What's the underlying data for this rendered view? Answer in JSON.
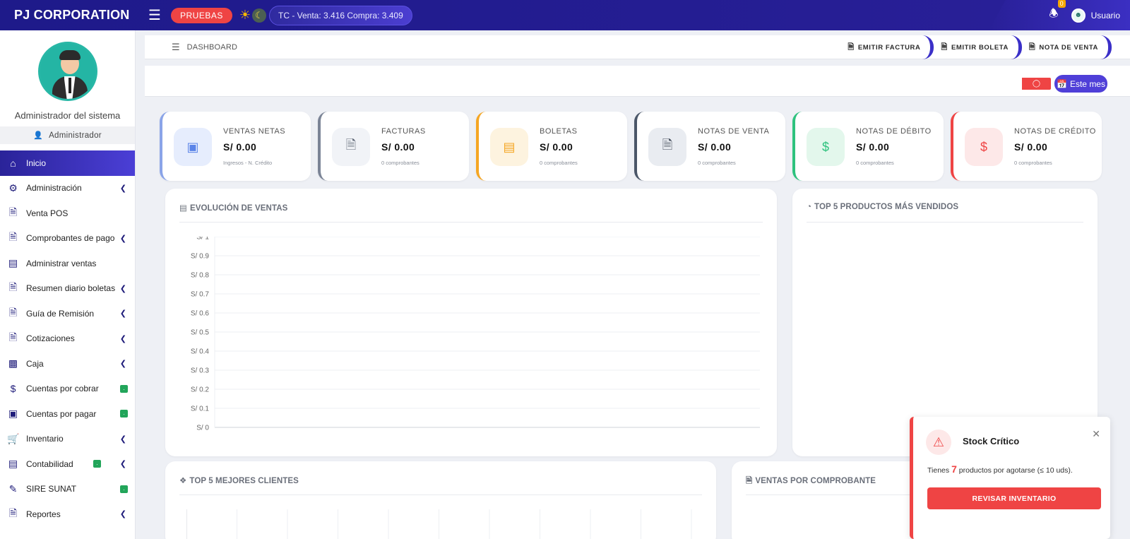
{
  "header": {
    "brand": "PJ CORPORATION",
    "env_badge": "PRUEBAS",
    "exchange_rate": "TC - Venta: 3.416 Compra: 3.409",
    "notification_count": "0",
    "user_label": "Usuario"
  },
  "sidebar": {
    "profile_name": "Administrador del sistema",
    "role": "Administrador",
    "items": [
      {
        "label": "Inicio",
        "icon": "home-icon"
      },
      {
        "label": "Administración",
        "icon": "gear-icon"
      },
      {
        "label": "Venta POS",
        "icon": "invoice-dollar-icon"
      },
      {
        "label": "Comprobantes de pago",
        "icon": "invoice-dollar-icon"
      },
      {
        "label": "Administrar ventas",
        "icon": "receipt-icon"
      },
      {
        "label": "Resumen diario boletas",
        "icon": "invoice-dollar-icon"
      },
      {
        "label": "Guía de Remisión",
        "icon": "file-icon"
      },
      {
        "label": "Cotizaciones",
        "icon": "file-icon"
      },
      {
        "label": "Caja",
        "icon": "cash-register-icon"
      },
      {
        "label": "Cuentas por cobrar",
        "icon": "hand-dollar-icon"
      },
      {
        "label": "Cuentas por pagar",
        "icon": "money-icon"
      },
      {
        "label": "Inventario",
        "icon": "cart-icon"
      },
      {
        "label": "Contabilidad",
        "icon": "book-icon"
      },
      {
        "label": "SIRE SUNAT",
        "icon": "edit-icon"
      },
      {
        "label": "Reportes",
        "icon": "invoice-dollar-icon"
      }
    ]
  },
  "breadcrumb": {
    "title": "DASHBOARD"
  },
  "quick_actions": [
    "EMITIR FACTURA",
    "EMITIR BOLETA",
    "NOTA DE VENTA"
  ],
  "filters": {
    "period_label": "Este mes"
  },
  "kpis": [
    {
      "label": "VENTAS NETAS",
      "value": "S/ 0.00",
      "sub": "Ingresos - N. Crédito",
      "color": "#8aa4e8"
    },
    {
      "label": "FACTURAS",
      "value": "S/ 0.00",
      "sub": "0 comprobantes",
      "color": "#7b8496"
    },
    {
      "label": "BOLETAS",
      "value": "S/ 0.00",
      "sub": "0 comprobantes",
      "color": "#f5a623"
    },
    {
      "label": "NOTAS DE VENTA",
      "value": "S/ 0.00",
      "sub": "0 comprobantes",
      "color": "#4a5668"
    },
    {
      "label": "NOTAS DE DÉBITO",
      "value": "S/ 0.00",
      "sub": "0 comprobantes",
      "color": "#2ec27e"
    },
    {
      "label": "NOTAS DE CRÉDITO",
      "value": "S/ 0.00",
      "sub": "0 comprobantes",
      "color": "#ef4444"
    }
  ],
  "panels": {
    "sales_evolution": "EVOLUCIÓN DE VENTAS",
    "top_products": "TOP 5 PRODUCTOS MÁS VENDIDOS",
    "top_clients": "TOP 5 MEJORES CLIENTES",
    "sales_by_doc": "VENTAS POR COMPROBANTE"
  },
  "chart_data": {
    "type": "line",
    "title": "EVOLUCIÓN DE VENTAS",
    "yticks": [
      "S/ 1",
      "S/ 0.9",
      "S/ 0.8",
      "S/ 0.7",
      "S/ 0.6",
      "S/ 0.5",
      "S/ 0.4",
      "S/ 0.3",
      "S/ 0.2",
      "S/ 0.1",
      "S/ 0"
    ],
    "ylim": [
      0,
      1
    ],
    "grid": true,
    "series": []
  },
  "toast": {
    "title": "Stock Crítico",
    "msg_prefix": "Tienes",
    "count": "7",
    "msg_suffix": "productos por agotarse (≤ 10 uds).",
    "button": "REVISAR INVENTARIO"
  }
}
